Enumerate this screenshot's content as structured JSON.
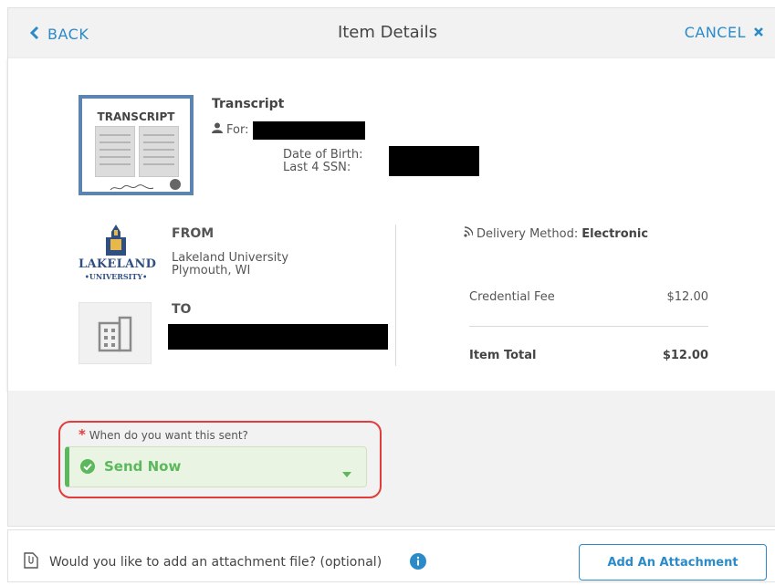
{
  "header": {
    "back_label": "BACK",
    "title": "Item Details",
    "cancel_label": "CANCEL"
  },
  "item": {
    "thumbnail_label": "TRANSCRIPT",
    "type": "Transcript",
    "for_label": "For:",
    "dob_label": "Date of Birth:",
    "ssn_label": "Last 4 SSN:"
  },
  "from": {
    "heading": "FROM",
    "institution": "Lakeland University",
    "location": "Plymouth, WI",
    "logo_line1": "LAKELAND",
    "logo_line2": "•UNIVERSITY•"
  },
  "to": {
    "heading": "TO"
  },
  "delivery": {
    "label": "Delivery Method:",
    "value": "Electronic"
  },
  "fees": {
    "credential_fee_label": "Credential Fee",
    "credential_fee_value": "$12.00",
    "item_total_label": "Item Total",
    "item_total_value": "$12.00"
  },
  "send": {
    "required_mark": "*",
    "question": "When do you want this sent?",
    "selected": "Send Now"
  },
  "attachment": {
    "prompt": "Would you like to add an attachment file? (optional)",
    "button_label": "Add An Attachment"
  },
  "colors": {
    "accent": "#2a8bc8",
    "success": "#5cb85c",
    "required": "#e23b3b"
  }
}
